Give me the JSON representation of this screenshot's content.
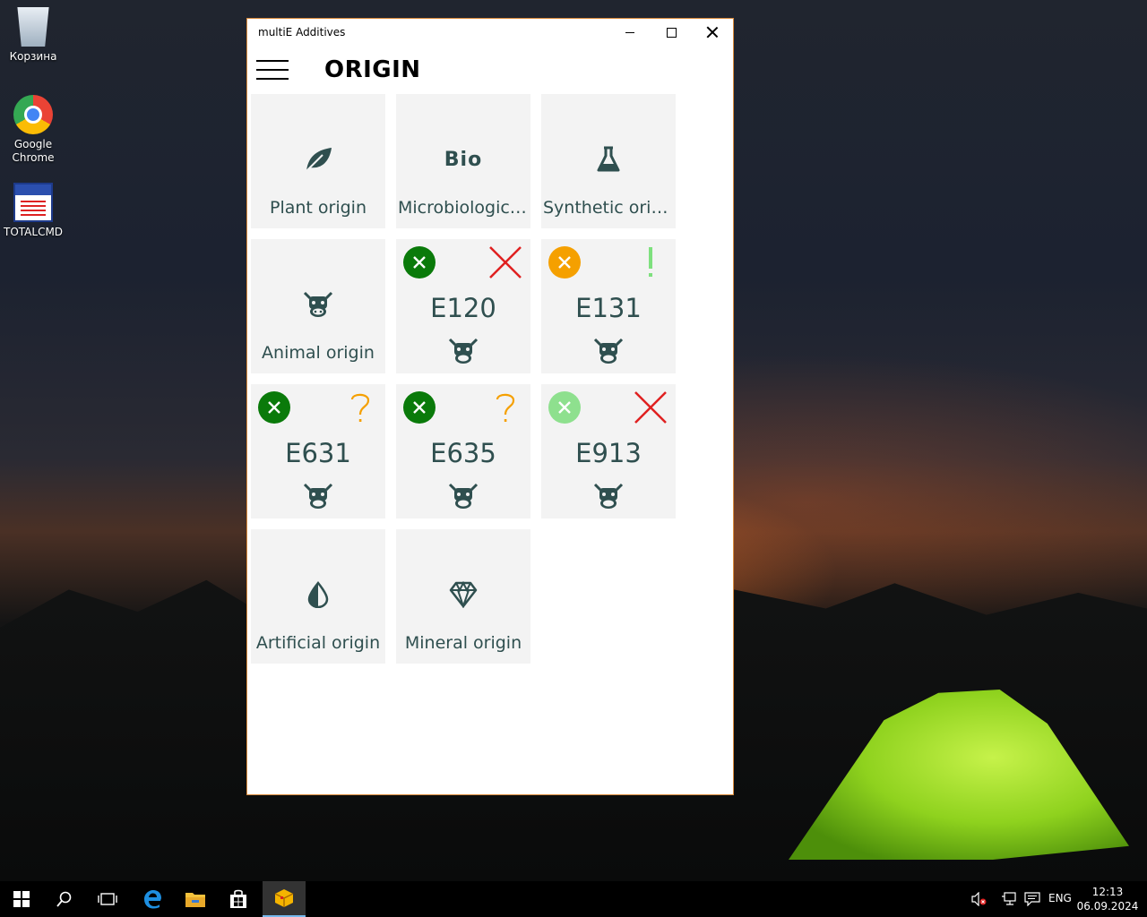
{
  "desktop": {
    "icons": [
      {
        "label": "Корзина"
      },
      {
        "label": "Google Chrome"
      },
      {
        "label": "TOTALCMD"
      }
    ]
  },
  "window": {
    "title": "multiE Additives",
    "header": {
      "title": "ORIGIN"
    }
  },
  "tiles": [
    {
      "type": "category",
      "label": "Plant origin",
      "icon": "leaf-icon"
    },
    {
      "type": "category",
      "label": "Microbiologica...",
      "icon": "bio-icon",
      "icon_text": "Bio"
    },
    {
      "type": "category",
      "label": "Synthetic origin",
      "icon": "flask-icon"
    },
    {
      "type": "category",
      "label": "Animal origin",
      "icon": "cow-icon"
    },
    {
      "type": "additive",
      "code": "E120",
      "badge": "dark",
      "status": "cross",
      "icon": "cow-icon"
    },
    {
      "type": "additive",
      "code": "E131",
      "badge": "orange",
      "status": "exclamation",
      "icon": "cow-icon"
    },
    {
      "type": "additive",
      "code": "E631",
      "badge": "dark",
      "status": "question",
      "icon": "cow-icon"
    },
    {
      "type": "additive",
      "code": "E635",
      "badge": "dark",
      "status": "question",
      "icon": "cow-icon"
    },
    {
      "type": "additive",
      "code": "E913",
      "badge": "light",
      "status": "cross",
      "icon": "cow-icon"
    },
    {
      "type": "category",
      "label": "Artificial origin",
      "icon": "half-drop-icon"
    },
    {
      "type": "category",
      "label": "Mineral origin",
      "icon": "diamond-icon"
    }
  ],
  "colors": {
    "badge_dark": "#0a7a0a",
    "badge_orange": "#f5a000",
    "badge_light": "#8ee08e",
    "cross": "#e02020",
    "question": "#f5a000",
    "exclamation": "#7ee07e",
    "tile_text": "#2f4f4f"
  },
  "taskbar": {
    "language": "ENG",
    "time": "12:13",
    "date": "06.09.2024"
  }
}
